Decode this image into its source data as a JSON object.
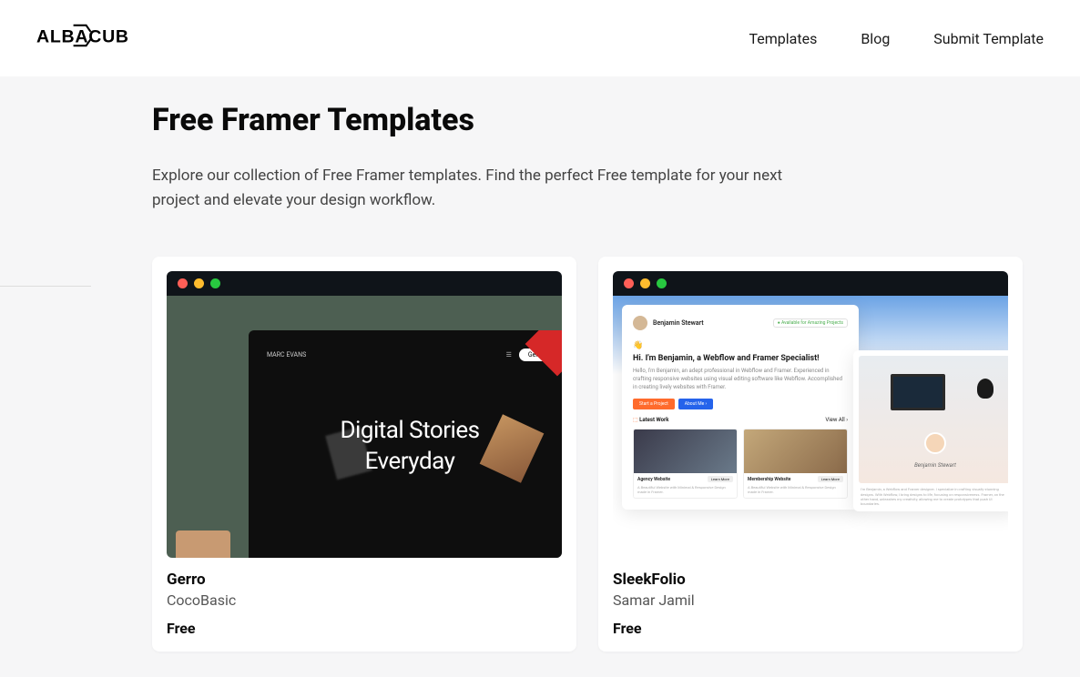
{
  "brand": "ALBACUB",
  "nav": {
    "templates": "Templates",
    "blog": "Blog",
    "submit": "Submit Template"
  },
  "page": {
    "title": "Free Framer Templates",
    "description": "Explore our collection of Free Framer templates. Find the perfect Free template for your next project and elevate your design workflow."
  },
  "templates": [
    {
      "title": "Gerro",
      "author": "CocoBasic",
      "price": "Free",
      "preview": {
        "brand_small": "MARC EVANS",
        "menu_label": "Gerro",
        "hero_line1": "Digital Stories",
        "hero_line2": "Everyday"
      }
    },
    {
      "title": "SleekFolio",
      "author": "Samar Jamil",
      "price": "Free",
      "preview": {
        "name": "Benjamin Stewart",
        "availability": "Available for Amazing Projects",
        "wave": "👋",
        "hero_title": "Hi. I'm Benjamin, a Webflow and Framer Specialist!",
        "hero_body": "Hello, I'm Benjamin, an adept professional in Webflow and Framer. Experienced in crafting responsive websites using visual editing software like Webflow. Accomplished in creating lively websites with Framer.",
        "btn_primary": "Start a Project",
        "btn_secondary": "About Me",
        "latest_work": "Latest Work",
        "view_all": "View All",
        "thumb1_title": "Agency Website",
        "thumb2_title": "Membership Website",
        "learn_more": "Learn More",
        "thumb_sub": "A Beautiful Website with Minimal & Responsive Design made in Framer.",
        "panel2_name": "Benjamin Stewart",
        "panel2_footer": "I'm Benjamin, a Webflow and Framer designer. I specialize in crafting visually stunning designs. With Webflow, I bring designs to life, focusing on responsiveness. Framer, on the other hand, unleashes my creativity, allowing me to create prototypes that push UI boundaries."
      }
    }
  ]
}
